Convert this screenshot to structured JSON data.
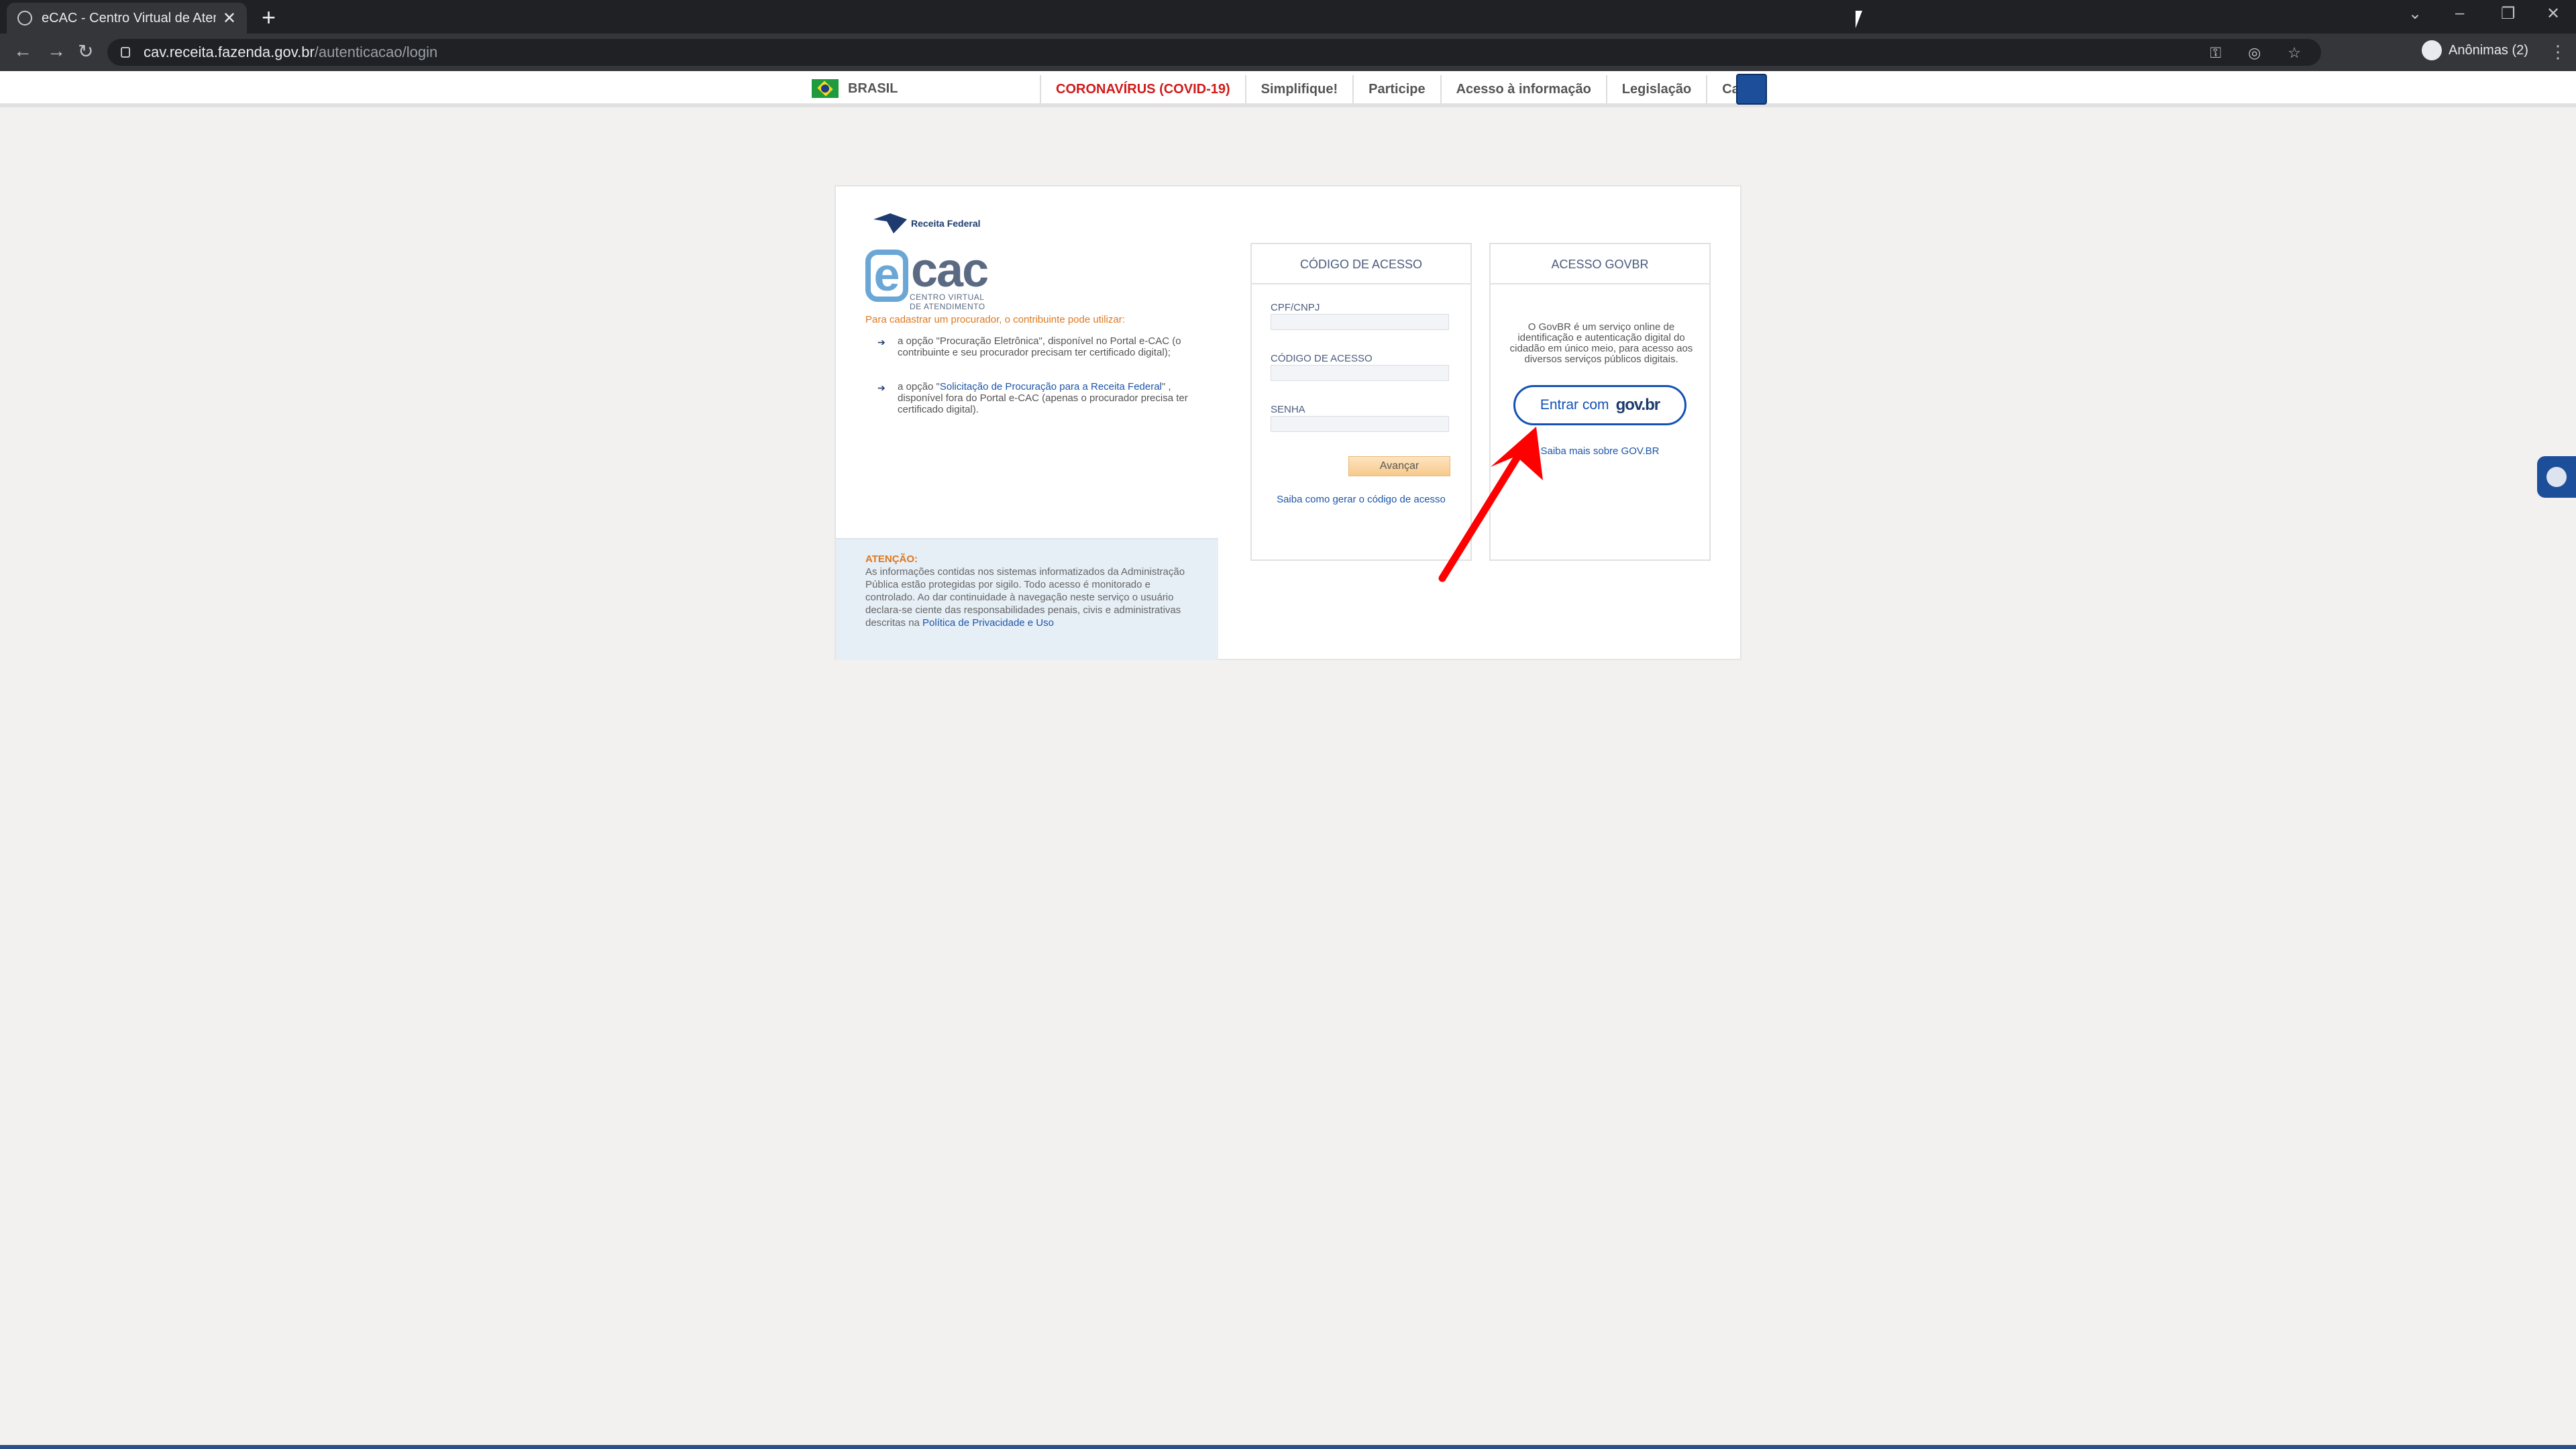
{
  "browser": {
    "tab_title": "eCAC - Centro Virtual de Atendim",
    "url_host": "cav.receita.fazenda.gov.br",
    "url_path": "/autenticacao/login",
    "profile_label": "Anônimas (2)"
  },
  "govbar": {
    "country": "BRASIL",
    "links": [
      "CORONAVÍRUS (COVID-19)",
      "Simplifique!",
      "Participe",
      "Acesso à informação",
      "Legislação",
      "Canais"
    ]
  },
  "brand": {
    "rf_name": "Receita Federal",
    "ecac_sub_1": "CENTRO VIRTUAL",
    "ecac_sub_2": "DE ATENDIMENTO"
  },
  "left": {
    "intro": "Para cadastrar um procurador, o contribuinte pode utilizar:",
    "opt1": "a opção \"Procuração Eletrônica\", disponível no Portal e-CAC (o contribuinte e seu procurador precisam ter certificado digital);",
    "opt2_pre": "a opção \"",
    "opt2_link": "Solicitação de Procuração para a Receita Federal",
    "opt2_post": "\" , disponível fora do Portal e-CAC (apenas o procurador precisa ter certificado digital).",
    "attention_title": "ATENÇÃO:",
    "attention_text": "As informações contidas nos sistemas informatizados da Administração Pública estão protegidas por sigilo. Todo acesso é monitorado e controlado. Ao dar continuidade à navegação neste serviço o usuário declara-se ciente das responsabilidades penais, civis e administrativas descritas na ",
    "attention_link": "Política de Privacidade e Uso"
  },
  "codigo": {
    "title": "CÓDIGO DE ACESSO",
    "cpf_label": "CPF/CNPJ",
    "codigo_label": "CÓDIGO DE ACESSO",
    "senha_label": "SENHA",
    "submit": "Avançar",
    "help_link": "Saiba como gerar o código de acesso"
  },
  "govbr": {
    "title": "ACESSO GOVBR",
    "description": "O GovBR é um serviço online de identificação e autenticação digital do cidadão em único meio, para acesso aos diversos serviços públicos digitais.",
    "button_prefix": "Entrar com",
    "button_brand": "gov.br",
    "more_link": "Saiba mais sobre GOV.BR"
  },
  "colors": {
    "accent": "#1351b4",
    "warning": "#e0781e",
    "annotation_arrow": "#ff0000"
  }
}
